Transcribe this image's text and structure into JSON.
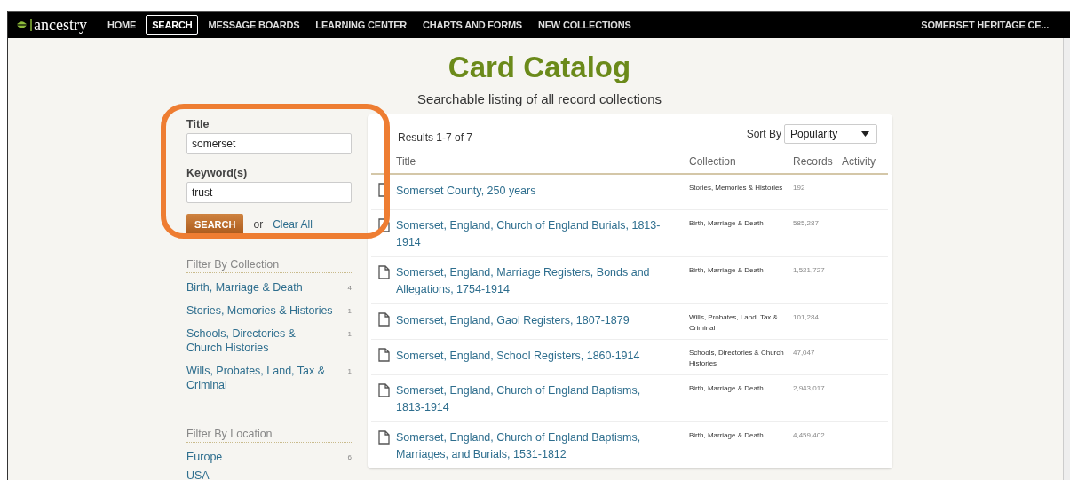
{
  "nav": {
    "logo": "ancestry",
    "items": [
      {
        "label": "HOME",
        "selected": false
      },
      {
        "label": "SEARCH",
        "selected": true
      },
      {
        "label": "MESSAGE BOARDS",
        "selected": false
      },
      {
        "label": "LEARNING CENTER",
        "selected": false
      },
      {
        "label": "CHARTS AND FORMS",
        "selected": false
      },
      {
        "label": "NEW COLLECTIONS",
        "selected": false
      }
    ],
    "account": "SOMERSET HERITAGE CE..."
  },
  "header": {
    "title": "Card Catalog",
    "subtitle": "Searchable listing of all record collections"
  },
  "search_form": {
    "fields": [
      {
        "label": "Title",
        "value": "somerset"
      },
      {
        "label": "Keyword(s)",
        "value": "trust"
      }
    ],
    "button": "SEARCH",
    "or": "or",
    "clear": "Clear All",
    "highlight": {
      "color": "#ee7d32"
    }
  },
  "filters": [
    {
      "heading": "Filter By Collection",
      "items": [
        {
          "label": "Birth, Marriage & Death",
          "count": "4"
        },
        {
          "label": "Stories, Memories & Histories",
          "count": "1"
        },
        {
          "label": "Schools, Directories & Church Histories",
          "count": "1"
        },
        {
          "label": "Wills, Probates, Land, Tax & Criminal",
          "count": "1"
        }
      ]
    },
    {
      "heading": "Filter By Location",
      "items": [
        {
          "label": "Europe",
          "count": "6"
        },
        {
          "label": "USA"
        }
      ]
    }
  ],
  "results": {
    "summary": "Results 1-7 of 7",
    "sort_label": "Sort By",
    "sort_value": "Popularity",
    "columns": [
      "Title",
      "Collection",
      "Records",
      "Activity"
    ],
    "rows": [
      {
        "title": "Somerset County, 250 years",
        "collection": "Stories, Memories & Histories",
        "records": "192"
      },
      {
        "title": "Somerset, England, Church of England Burials, 1813-1914",
        "collection": "Birth, Marriage & Death",
        "records": "585,287"
      },
      {
        "title": "Somerset, England, Marriage Registers, Bonds and Allegations, 1754-1914",
        "collection": "Birth, Marriage & Death",
        "records": "1,521,727"
      },
      {
        "title": "Somerset, England, Gaol Registers, 1807-1879",
        "collection": "Wills, Probates, Land, Tax & Criminal",
        "records": "101,284"
      },
      {
        "title": "Somerset, England, School Registers, 1860-1914",
        "collection": "Schools, Directories & Church Histories",
        "records": "47,047"
      },
      {
        "title": "Somerset, England, Church of England Baptisms, 1813-1914",
        "collection": "Birth, Marriage & Death",
        "records": "2,943,017"
      },
      {
        "title": "Somerset, England, Church of England Baptisms, Marriages, and Burials, 1531-1812",
        "collection": "Birth, Marriage & Death",
        "records": "4,459,402"
      }
    ]
  }
}
